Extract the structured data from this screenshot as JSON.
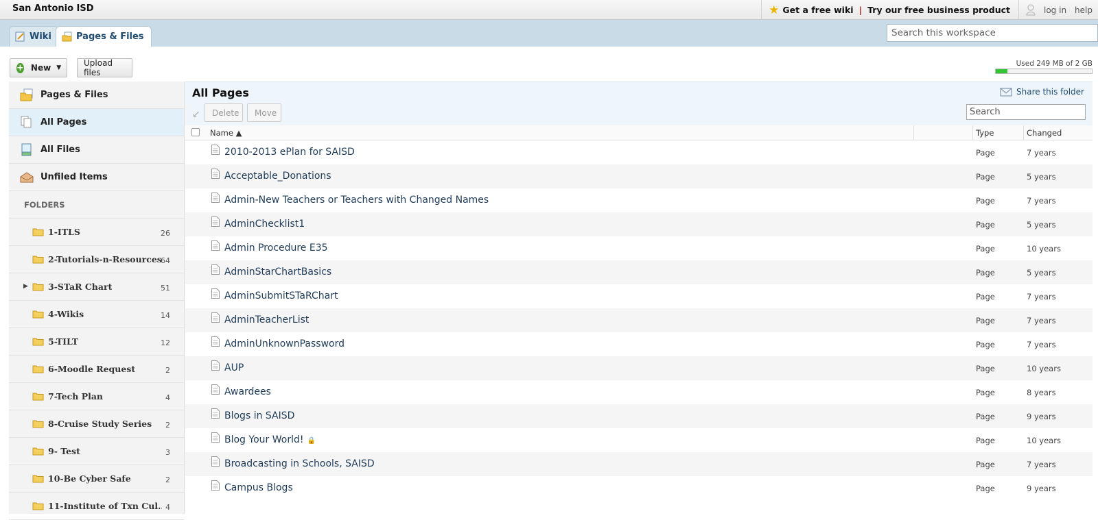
{
  "site": {
    "title": "San Antonio ISD"
  },
  "top_links": {
    "free_wiki": "Get a free wiki",
    "separator": "|",
    "business": "Try our free business product",
    "login": "log in",
    "help": "help"
  },
  "tabs": [
    {
      "label": "Wiki",
      "icon": "wiki-icon"
    },
    {
      "label": "Pages & Files",
      "icon": "pages-files-icon"
    }
  ],
  "workspace_search": {
    "placeholder": "Search this workspace"
  },
  "toolbar": {
    "new_label": "New",
    "upload_label": "Upload files"
  },
  "usage": {
    "text": "Used 249 MB of 2 GB",
    "fraction": 0.12,
    "fill_color": "#35c235"
  },
  "sidebar": {
    "items": [
      {
        "label": "Pages & Files",
        "icon": "pages-files-icon"
      },
      {
        "label": "All Pages",
        "icon": "all-pages-icon",
        "active": true
      },
      {
        "label": "All Files",
        "icon": "all-files-icon"
      },
      {
        "label": "Unfiled Items",
        "icon": "unfiled-icon"
      }
    ],
    "folders_header": "FOLDERS",
    "folders": [
      {
        "name": "1-ITLS",
        "count": "26"
      },
      {
        "name": "2-Tutorials-n-Resources",
        "count": "64"
      },
      {
        "name": "3-STaR Chart",
        "count": "51",
        "expandable": true
      },
      {
        "name": "4-Wikis",
        "count": "14"
      },
      {
        "name": "5-TILT",
        "count": "12"
      },
      {
        "name": "6-Moodle Request",
        "count": "2"
      },
      {
        "name": "7-Tech Plan",
        "count": "4"
      },
      {
        "name": "8-Cruise Study Series",
        "count": "2"
      },
      {
        "name": "9- Test",
        "count": "3"
      },
      {
        "name": "10-Be Cyber Safe",
        "count": "2"
      },
      {
        "name": "11-Institute of Txn Cul...",
        "count": "4"
      }
    ]
  },
  "main": {
    "title": "All Pages",
    "share_label": "Share this folder",
    "delete_label": "Delete",
    "move_label": "Move",
    "search_placeholder": "Search",
    "columns": {
      "name": "Name ▲",
      "type": "Type",
      "changed": "Changed"
    },
    "rows": [
      {
        "name": "2010-2013 ePlan for SAISD",
        "type": "Page",
        "changed": "7 years"
      },
      {
        "name": "Acceptable_Donations",
        "type": "Page",
        "changed": "5 years"
      },
      {
        "name": "Admin-New Teachers or Teachers with Changed Names",
        "type": "Page",
        "changed": "7 years"
      },
      {
        "name": "AdminChecklist1",
        "type": "Page",
        "changed": "5 years"
      },
      {
        "name": "Admin Procedure E35",
        "type": "Page",
        "changed": "10 years"
      },
      {
        "name": "AdminStarChartBasics",
        "type": "Page",
        "changed": "5 years"
      },
      {
        "name": "AdminSubmitSTaRChart",
        "type": "Page",
        "changed": "7 years"
      },
      {
        "name": "AdminTeacherList",
        "type": "Page",
        "changed": "7 years"
      },
      {
        "name": "AdminUnknownPassword",
        "type": "Page",
        "changed": "7 years"
      },
      {
        "name": "AUP",
        "type": "Page",
        "changed": "10 years"
      },
      {
        "name": "Awardees",
        "type": "Page",
        "changed": "8 years"
      },
      {
        "name": "Blogs in SAISD",
        "type": "Page",
        "changed": "9 years"
      },
      {
        "name": "Blog Your World!",
        "type": "Page",
        "changed": "10 years",
        "locked": true
      },
      {
        "name": "Broadcasting in Schools, SAISD",
        "type": "Page",
        "changed": "7 years"
      },
      {
        "name": "Campus Blogs",
        "type": "Page",
        "changed": "9 years"
      }
    ]
  }
}
